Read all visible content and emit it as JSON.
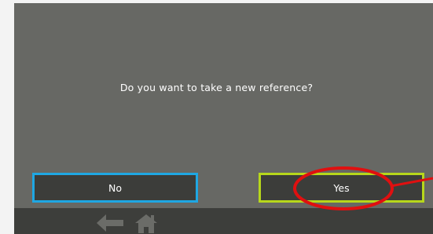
{
  "dialog": {
    "question": "Do you want to take a new reference?",
    "no_label": "No",
    "yes_label": "Yes"
  },
  "colors": {
    "background": "#676864",
    "button_fill": "#3c3d3a",
    "no_border": "#1fa7e3",
    "yes_border": "#b7d71b",
    "annotation": "#e01010"
  },
  "nav": {
    "icons": [
      "back-arrow-icon",
      "home-icon"
    ]
  }
}
